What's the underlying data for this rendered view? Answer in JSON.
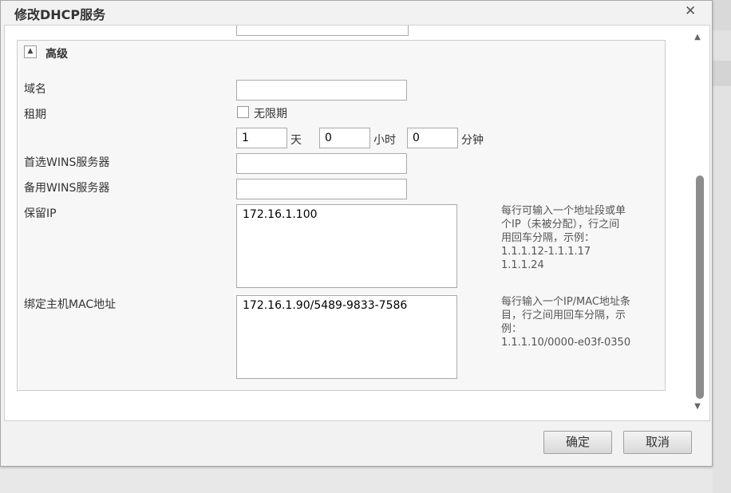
{
  "dialog": {
    "title": "修改DHCP服务"
  },
  "section": {
    "title": "高级"
  },
  "form": {
    "domain_label": "域名",
    "domain_value": "",
    "lease_label": "租期",
    "unlimited_label": "无限期",
    "unlimited_checked": false,
    "lease_days_value": "1",
    "days_unit": "天",
    "lease_hours_value": "0",
    "hours_unit": "小时",
    "lease_minutes_value": "0",
    "minutes_unit": "分钟",
    "primary_wins_label": "首选WINS服务器",
    "primary_wins_value": "",
    "backup_wins_label": "备用WINS服务器",
    "backup_wins_value": "",
    "reserved_ip_label": "保留IP",
    "reserved_ip_value": "172.16.1.100",
    "reserved_ip_hint": {
      "line1": "每行可输入一个地址段或单",
      "line2": "个IP（未被分配），行之间",
      "line3": "用回车分隔，示例：",
      "line4": "1.1.1.12-1.1.1.17",
      "line5": "1.1.1.24"
    },
    "mac_bind_label": "绑定主机MAC地址",
    "mac_bind_value": "172.16.1.90/5489-9833-7586",
    "mac_bind_hint": {
      "line1": "每行输入一个IP/MAC地址条",
      "line2": "目，行之间用回车分隔，示",
      "line3": "例：",
      "line4": "1.1.1.10/0000-e03f-0350"
    }
  },
  "buttons": {
    "ok": "确定",
    "cancel": "取消"
  },
  "icons": {
    "close": "close-icon",
    "collapse": "collapse-up-icon",
    "scroll_up": "scroll-up-arrow-icon",
    "scroll_down": "scroll-down-arrow-icon"
  }
}
